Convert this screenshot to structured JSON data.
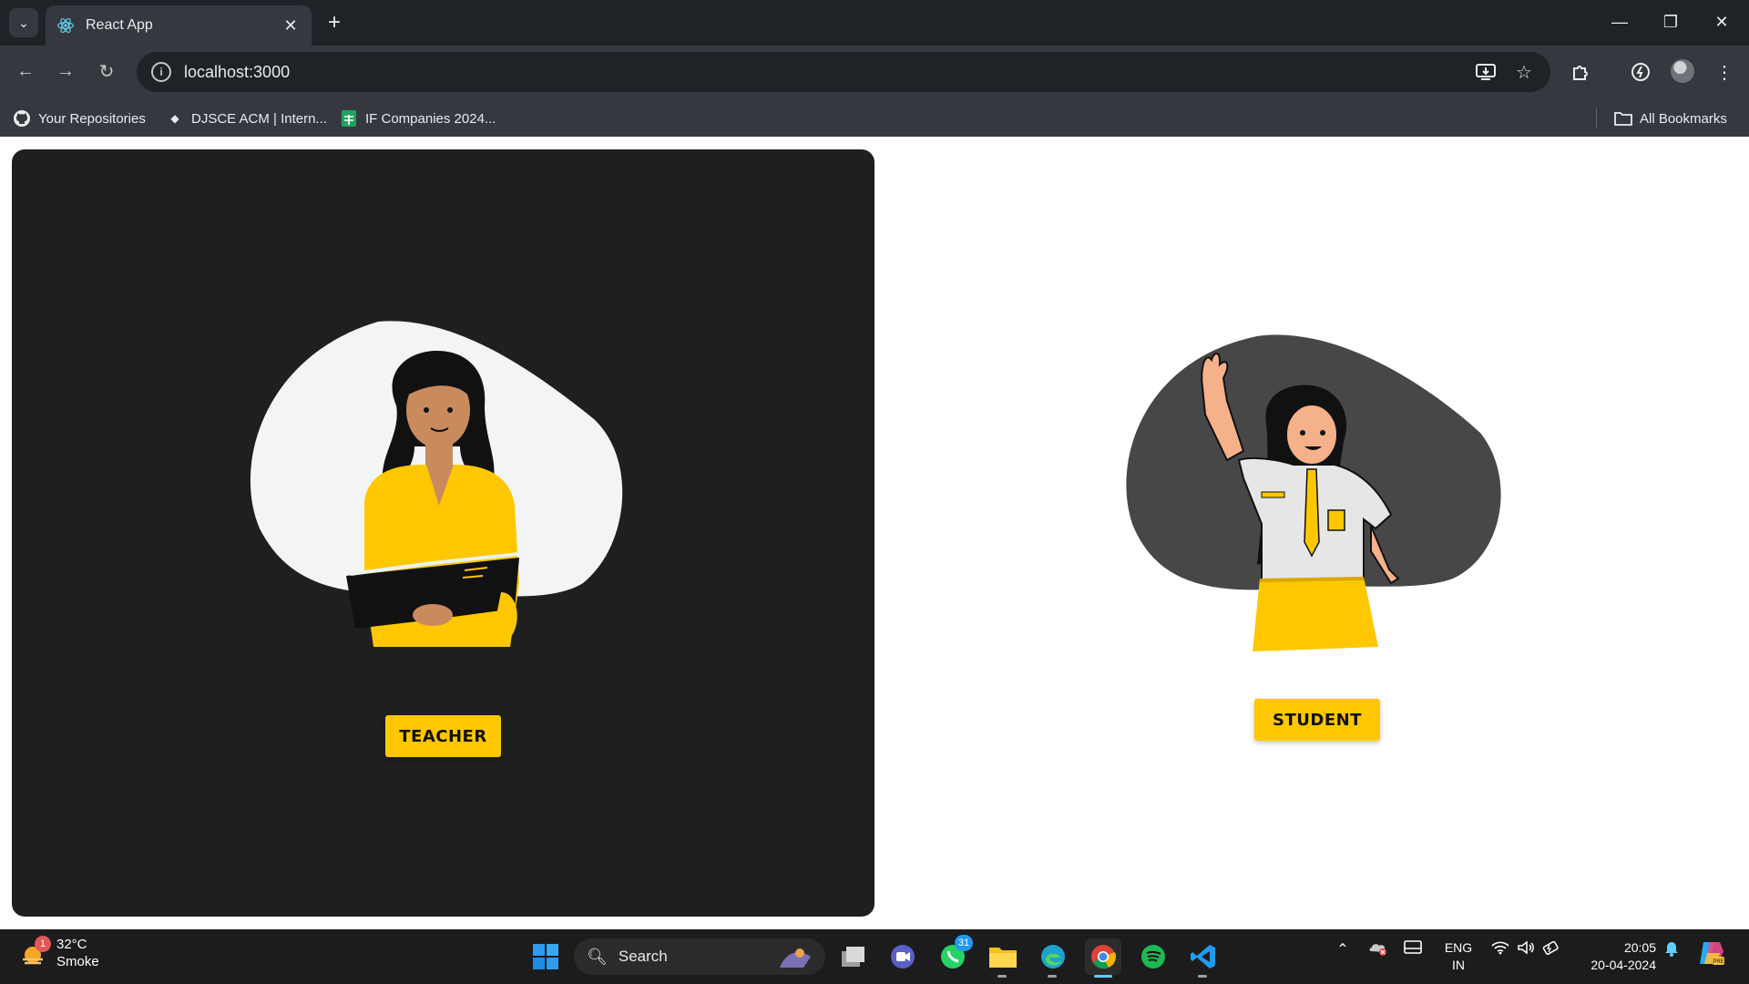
{
  "browser": {
    "tab_title": "React App",
    "url": "localhost:3000",
    "bookmarks": [
      {
        "label": "Your Repositories",
        "icon": "github-icon"
      },
      {
        "label": "DJSCE ACM | Intern...",
        "icon": "acm-icon"
      },
      {
        "label": "IF Companies 2024...",
        "icon": "sheets-icon"
      }
    ],
    "all_bookmarks": "All Bookmarks"
  },
  "page": {
    "teacher_button": "TEACHER",
    "student_button": "STUDENT",
    "accent_color": "#ffc700",
    "dark_card_color": "#1f1f1f"
  },
  "taskbar": {
    "weather_temp": "32°C",
    "weather_condition": "Smoke",
    "weather_badge": "1",
    "search_label": "Search",
    "whatsapp_badge": "31",
    "lang_line1": "ENG",
    "lang_line2": "IN",
    "time": "20:05",
    "date": "20-04-2024"
  }
}
